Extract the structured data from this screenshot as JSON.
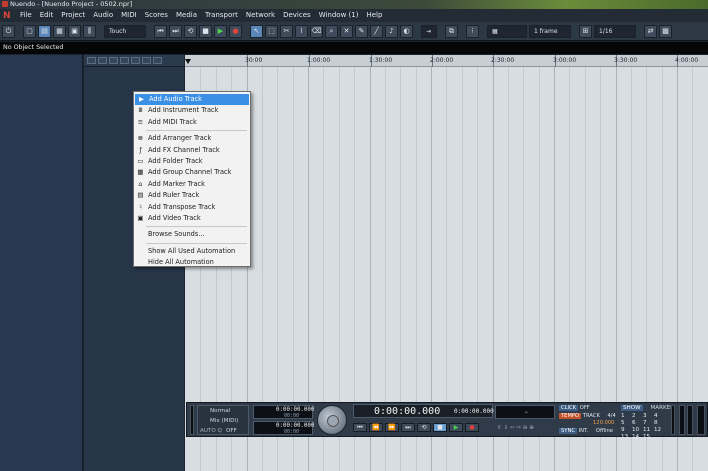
{
  "window": {
    "title": "Nuendo - [Nuendo Project - 0502.npr]"
  },
  "menu": [
    "File",
    "Edit",
    "Project",
    "Audio",
    "MIDI",
    "Scores",
    "Media",
    "Transport",
    "Network",
    "Devices",
    "Window (1)",
    "Help"
  ],
  "toolbar": {
    "automation_mode": "Touch",
    "quantize_frame": "1 frame",
    "quantize_value": "1/16"
  },
  "infoline": {
    "text": "No Object Selected"
  },
  "ruler": {
    "labels": [
      "30:00",
      "1:00:00",
      "1:30:00",
      "2:00:00",
      "2:30:00",
      "3:00:00",
      "3:30:00",
      "4:00:00"
    ]
  },
  "context_menu": {
    "groups": [
      [
        {
          "label": "Add Audio Track",
          "icon": "audio-track-icon",
          "glyph": "▶",
          "highlight": true
        },
        {
          "label": "Add Instrument Track",
          "icon": "instrument-track-icon",
          "glyph": "Ⅲ"
        },
        {
          "label": "Add MIDI Track",
          "icon": "midi-track-icon",
          "glyph": "≡"
        }
      ],
      [
        {
          "label": "Add Arranger Track",
          "icon": "arranger-track-icon",
          "glyph": "≣"
        },
        {
          "label": "Add FX Channel Track",
          "icon": "fx-channel-icon",
          "glyph": "ƒ"
        },
        {
          "label": "Add Folder Track",
          "icon": "folder-icon",
          "glyph": "▭"
        },
        {
          "label": "Add Group Channel Track",
          "icon": "group-channel-icon",
          "glyph": "▦"
        },
        {
          "label": "Add Marker Track",
          "icon": "marker-icon",
          "glyph": "⌂"
        },
        {
          "label": "Add Ruler Track",
          "icon": "ruler-icon",
          "glyph": "▤"
        },
        {
          "label": "Add Transpose Track",
          "icon": "transpose-icon",
          "glyph": "♮"
        },
        {
          "label": "Add Video Track",
          "icon": "video-icon",
          "glyph": "▣"
        }
      ],
      [
        {
          "label": "Browse Sounds...",
          "icon": "",
          "glyph": ""
        }
      ],
      [
        {
          "label": "Show All Used Automation",
          "icon": "",
          "glyph": ""
        },
        {
          "label": "Hide All Automation",
          "icon": "",
          "glyph": ""
        }
      ]
    ]
  },
  "transport": {
    "mode_normal": "Normal",
    "mode_mix": "Mix (MIDI)",
    "auto_label": "AUTO Q",
    "auto_value": "OFF",
    "left_locator": "0:00:00.000",
    "left_locator_sub": "00:00",
    "right_locator": "0:00:00.000",
    "right_locator_sub": "00:00",
    "main_time": "0:00:00.000",
    "secondary_time": "0:00:00.000",
    "click_label": "CLICK",
    "click_value": "OFF",
    "tempo_label": "TEMPO",
    "track_label": "TRACK",
    "signature": "4/4",
    "tempo_value": "120.000",
    "sync_label": "SYNC",
    "sync_int": "INT.",
    "sync_offline": "Offline",
    "show_label": "SHOW",
    "marker_label": "MARKER",
    "marker_numbers": [
      "1",
      "2",
      "3",
      "4",
      "5",
      "6",
      "7",
      "8",
      "9",
      "10",
      "11",
      "12",
      "13",
      "14",
      "15"
    ]
  },
  "colors": {
    "menu_highlight": "#3b8fe5",
    "arrange_bg": "#d7dde1",
    "tempo_badge": "#c2542d"
  }
}
